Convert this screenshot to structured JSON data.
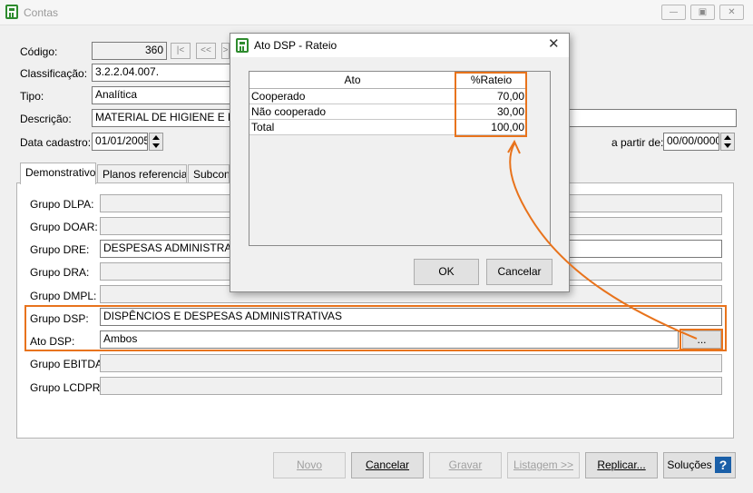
{
  "window": {
    "title": "Contas",
    "minimize_glyph": "—",
    "restore_glyph": "▣",
    "close_glyph": "✕"
  },
  "form": {
    "codigo_label": "Código:",
    "codigo_value": "360",
    "nav_first": "|<",
    "nav_prev": "<<",
    "nav_next": ">",
    "classificacao_label": "Classificação:",
    "classificacao_value": "3.2.2.04.007.",
    "tipo_label": "Tipo:",
    "tipo_value": "Analítica",
    "descricao_label": "Descrição:",
    "descricao_value": "MATERIAL DE HIGIENE E LIMPEZA",
    "data_cadastro_label": "Data cadastro:",
    "data_cadastro_value": "01/01/2005",
    "a_partir_label": "a partir de:",
    "a_partir_value": "00/00/0000"
  },
  "tabs": [
    {
      "label": "Demonstrativos"
    },
    {
      "label": "Planos referenciais"
    },
    {
      "label": "Subcontas"
    }
  ],
  "groups": {
    "dlpa_label": "Grupo DLPA:",
    "dlpa_value": "",
    "doar_label": "Grupo DOAR:",
    "doar_value": "",
    "dre_label": "Grupo DRE:",
    "dre_value": "DESPESAS ADMINISTRATIVAS",
    "dra_label": "Grupo DRA:",
    "dra_value": "",
    "dmpl_label": "Grupo DMPL:",
    "dmpl_value": "",
    "dsp_label": "Grupo DSP:",
    "dsp_value": "DISPÊNCIOS E DESPESAS ADMINISTRATIVAS",
    "ato_dsp_label": "Ato DSP:",
    "ato_dsp_value": "Ambos",
    "ato_dsp_button": "...",
    "ebitda_label": "Grupo EBITDA:",
    "ebitda_value": "",
    "lcdpr_label": "Grupo LCDPR:",
    "lcdpr_value": ""
  },
  "buttons": {
    "novo": "Novo",
    "cancelar": "Cancelar",
    "gravar": "Gravar",
    "listagem": "Listagem >>",
    "replicar": "Replicar...",
    "solucoes": "Soluções",
    "help_glyph": "?"
  },
  "dialog": {
    "title": "Ato DSP - Rateio",
    "close_glyph": "✕",
    "columns": [
      "Ato",
      "%Rateio"
    ],
    "rows": [
      {
        "ato": "Cooperado",
        "rateio": "70,00"
      },
      {
        "ato": "Não cooperado",
        "rateio": "30,00"
      },
      {
        "ato": "Total",
        "rateio": "100,00"
      }
    ],
    "ok": "OK",
    "cancelar": "Cancelar"
  },
  "colors": {
    "highlight": "#e8731c",
    "icon_green": "#2e8b2e",
    "help_blue": "#1a5fa8"
  },
  "icons": {
    "app": "calculator-icon",
    "help": "help-icon"
  }
}
